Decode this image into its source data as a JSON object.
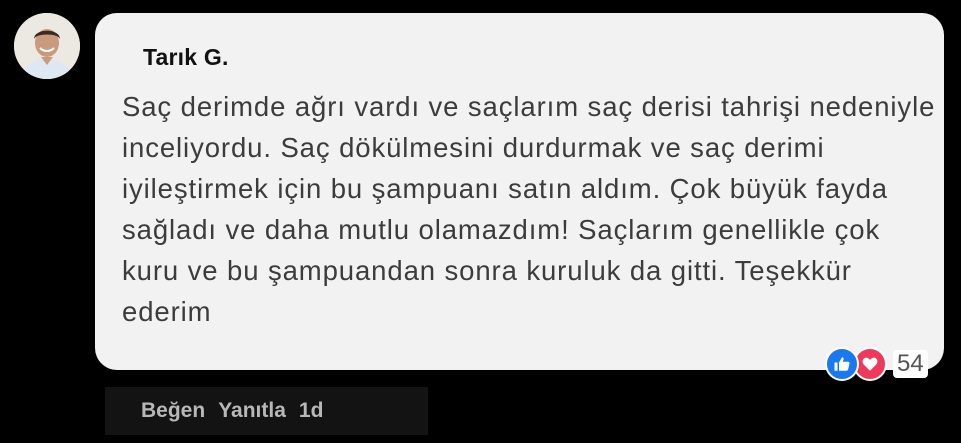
{
  "comment": {
    "author": "Tarık G.",
    "text": "Saç derimde ağrı vardı ve saçlarım saç derisi tahrişi nedeniyle inceliyordu. Saç dökülmesini durdurmak ve saç derimi iyileştirmek için bu şampuanı satın aldım. Çok büyük fayda sağladı ve daha mutlu olamazdım! Saçlarım genellikle çok kuru ve bu şampuandan sonra kuruluk da gitti. Teşekkür ederim",
    "reactions": {
      "icons": [
        "like-icon",
        "love-icon"
      ],
      "count": "54",
      "like_color": "#1a79f0",
      "love_color": "#f0395a"
    },
    "actions": {
      "like_label": "Beğen",
      "reply_label": "Yanıtla",
      "timestamp": "1d"
    }
  },
  "colors": {
    "background": "#000000",
    "bubble": "#f2f2f2",
    "text": "#3c3c3c"
  }
}
